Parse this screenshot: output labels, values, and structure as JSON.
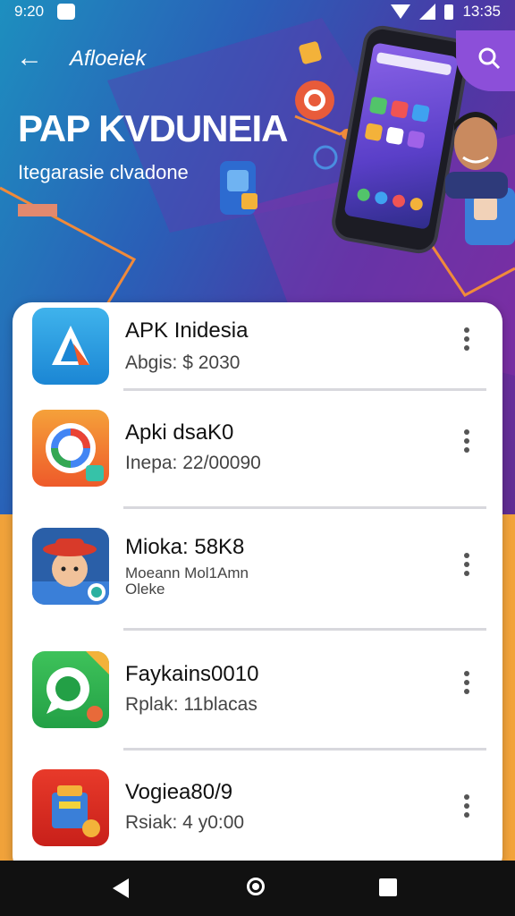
{
  "status_bar": {
    "time": "9:20",
    "clock": "13:35"
  },
  "app_bar": {
    "title": "Afloeiek"
  },
  "hero": {
    "title": "PAP KVDUNEIA",
    "subtitle": "Itegarasie clvadone"
  },
  "apps": [
    {
      "name": "APK Inidesia",
      "meta": "Abgis: $ 2030",
      "icon": "apk-logo-icon"
    },
    {
      "name": "Apki dsaK0",
      "meta": "Inepa: 22/00090",
      "icon": "gear-g-icon"
    },
    {
      "name": "Mioka: 58K8",
      "meta": "Moeann Mol1Amn",
      "meta2": "Oleke",
      "icon": "avatar-character-icon"
    },
    {
      "name": "Faykains0010",
      "meta": "Rplak: 11blacas",
      "icon": "chat-bubble-icon"
    },
    {
      "name": "Vogiea80/9",
      "meta": "Rsiak: 4 y0:00",
      "icon": "toolbox-icon"
    }
  ],
  "colors": {
    "accent": "#8c4fd9",
    "hero_gradient_start": "#1d8fbf",
    "hero_gradient_end": "#6b2f9f",
    "lower_background": "#f2a33a",
    "card": "#ffffff"
  }
}
